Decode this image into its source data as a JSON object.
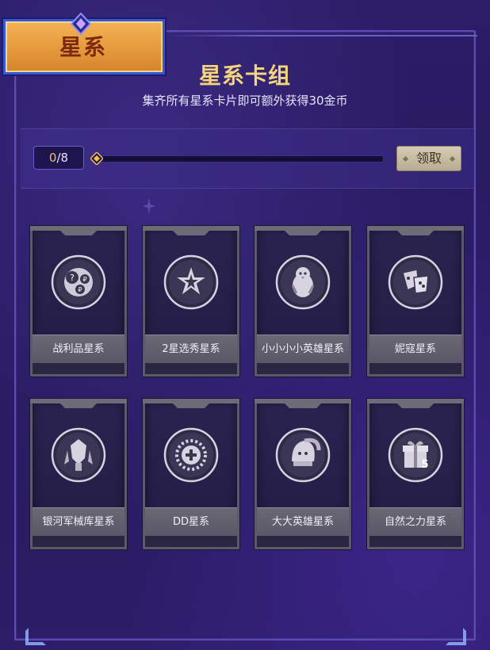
{
  "badge": {
    "title": "星系"
  },
  "header": {
    "title": "星系卡组",
    "subtitle": "集齐所有星系卡片即可额外获得30金币"
  },
  "progress": {
    "current": "0",
    "total": "/8",
    "fraction": 0.0,
    "claim_label": "领取"
  },
  "cards": [
    {
      "label": "战利品星系",
      "icon": "loot-orbs-icon"
    },
    {
      "label": "2星选秀星系",
      "icon": "star-burst-icon"
    },
    {
      "label": "小小小小英雄星系",
      "icon": "penguin-icon"
    },
    {
      "label": "妮寇星系",
      "icon": "masks-icon"
    },
    {
      "label": "银河军械库星系",
      "icon": "armory-icon"
    },
    {
      "label": "DD星系",
      "icon": "coin-plus-icon"
    },
    {
      "label": "大大英雄星系",
      "icon": "hooded-penguin-icon"
    },
    {
      "label": "自然之力星系",
      "icon": "gift-five-icon"
    }
  ],
  "colors": {
    "background": "#2a1c62",
    "gold": "#f5c04e",
    "badge_orange": "#e59a3c",
    "frame": "#5b4bb3"
  }
}
